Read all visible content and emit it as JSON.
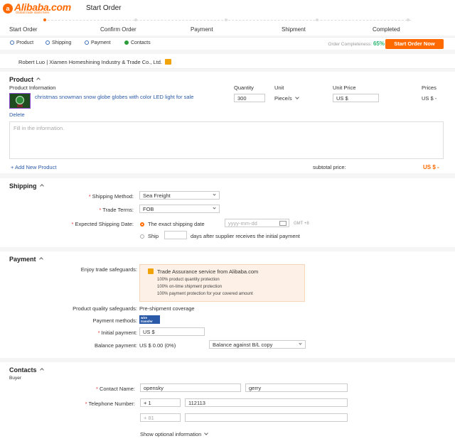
{
  "brand": {
    "name": "Alibaba.com",
    "tagline": "Global trade starts here."
  },
  "header": {
    "title": "Start Order"
  },
  "steps": [
    "Start Order",
    "Confirm Order",
    "Payment",
    "Shipment",
    "Completed"
  ],
  "section_nav": {
    "items": [
      "Product",
      "Shipping",
      "Payment",
      "Contacts"
    ],
    "completeness_label": "Order Completeness:",
    "completeness_value": "65%",
    "start_button": "Start Order Now"
  },
  "supplier": {
    "text": "Robert Luo | Xiamen Homeshining Industry & Trade Co., Ltd."
  },
  "product": {
    "title": "Product",
    "columns": {
      "info": "Product Information",
      "quantity": "Quantity",
      "unit": "Unit",
      "unit_price": "Unit Price",
      "prices": "Prices"
    },
    "item": {
      "name": "christmas snowman snow globe globes with color LED light for sale",
      "quantity": "300",
      "unit": "Piece/s",
      "unit_price": "US $",
      "price": "US $ -"
    },
    "delete_label": "Delete",
    "notes_placeholder": "Fill in the information.",
    "add_label": "+ Add New Product",
    "subtotal_label": "subtotal price:",
    "subtotal_value": "US $ -"
  },
  "shipping": {
    "title": "Shipping",
    "method_label": "Shipping Method:",
    "method_value": "Sea Freight",
    "terms_label": "Trade Terms:",
    "terms_value": "FOB",
    "date_label": "Expected Shipping Date:",
    "exact_label": "The exact shipping date",
    "date_placeholder": "yyyy-mm-dd",
    "timezone": "GMT +8",
    "ship_label": "Ship",
    "days_label": "days after supplier receives the initial payment"
  },
  "payment": {
    "title": "Payment",
    "safeguards_label": "Enjoy trade safeguards:",
    "ta_title": "Trade Assurance service from Alibaba.com",
    "ta_points": [
      "100% product quantity protection",
      "100% on-time shipment protection",
      "100% payment protection for your covered amount"
    ],
    "quality_label": "Product quality safeguards:",
    "quality_value": "Pre-shipment coverage",
    "methods_label": "Payment methods:",
    "wire_badge": "wire transfer",
    "initial_label": "Initial payment:",
    "initial_value": "US $",
    "balance_label": "Balance payment:",
    "balance_value": "US $ 0.00 (0%)",
    "balance_select": "Balance against B/L copy"
  },
  "contacts": {
    "title": "Contacts",
    "subtitle": "Buyer",
    "name_label": "Contact Name:",
    "first_name": "opensky",
    "last_name": "gerry",
    "phone_label": "Telephone Number:",
    "country_code": "+ 1",
    "phone": "112113",
    "mobile_code": "+ 81",
    "optional_label": "Show optional information"
  },
  "colors": {
    "accent": "#ff6a00",
    "link": "#2b5ba8",
    "success": "#2bb673",
    "required": "#e4393c",
    "ta_bg": "#fdf0e6"
  }
}
